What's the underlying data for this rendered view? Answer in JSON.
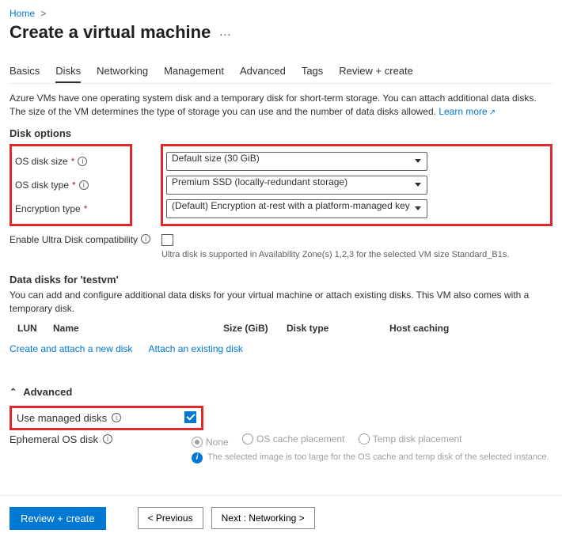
{
  "breadcrumb": {
    "home": "Home"
  },
  "title": "Create a virtual machine",
  "tabs": [
    "Basics",
    "Disks",
    "Networking",
    "Management",
    "Advanced",
    "Tags",
    "Review + create"
  ],
  "active_tab": "Disks",
  "description": "Azure VMs have one operating system disk and a temporary disk for short-term storage. You can attach additional data disks. The size of the VM determines the type of storage you can use and the number of data disks allowed.",
  "learn_more": "Learn more",
  "disk_options": {
    "heading": "Disk options",
    "os_disk_size": {
      "label": "OS disk size",
      "value": "Default size (30 GiB)"
    },
    "os_disk_type": {
      "label": "OS disk type",
      "value": "Premium SSD (locally-redundant storage)"
    },
    "encryption_type": {
      "label": "Encryption type",
      "value": "(Default) Encryption at-rest with a platform-managed key"
    }
  },
  "ultra": {
    "label": "Enable Ultra Disk compatibility",
    "hint": "Ultra disk is supported in Availability Zone(s) 1,2,3 for the selected VM size Standard_B1s."
  },
  "data_disks": {
    "heading": "Data disks for 'testvm'",
    "desc": "You can add and configure additional data disks for your virtual machine or attach existing disks. This VM also comes with a temporary disk.",
    "cols": {
      "lun": "LUN",
      "name": "Name",
      "size": "Size (GiB)",
      "dtype": "Disk type",
      "cache": "Host caching"
    },
    "create_link": "Create and attach a new disk",
    "attach_link": "Attach an existing disk"
  },
  "advanced": {
    "toggle": "Advanced",
    "use_managed": {
      "label": "Use managed disks",
      "checked": true
    },
    "ephemeral": {
      "label": "Ephemeral OS disk",
      "options": [
        "None",
        "OS cache placement",
        "Temp disk placement"
      ],
      "selected": "None",
      "hint": "The selected image is too large for the OS cache and temp disk of the selected instance."
    }
  },
  "footer": {
    "review": "Review + create",
    "prev": "< Previous",
    "next": "Next : Networking >"
  }
}
